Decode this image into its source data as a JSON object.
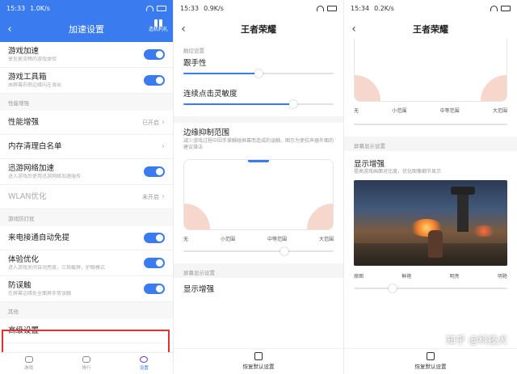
{
  "panel1": {
    "status": {
      "time": "15:33",
      "speed": "1.0K/s"
    },
    "title": "加速设置",
    "header_button": "造机利礼",
    "rows": [
      {
        "type": "toggle",
        "title": "游戏加速",
        "sub": "享受更流畅的游戏体验",
        "on": true
      },
      {
        "type": "toggle",
        "title": "游戏工具箱",
        "sub": "由屏幕右侧边缘向左滑出",
        "on": true
      },
      {
        "type": "header",
        "title": "性能增强"
      },
      {
        "type": "link",
        "title": "性能增强",
        "value": "已开启"
      },
      {
        "type": "link",
        "title": "内存清理白名单"
      },
      {
        "type": "toggle",
        "title": "迅游网络加速",
        "sub": "进入游戏后使用迅游网络加速服务",
        "on": true
      },
      {
        "type": "link",
        "title": "WLAN优化",
        "value": "未开启",
        "dim": true
      },
      {
        "type": "header",
        "title": "游戏防打扰"
      },
      {
        "type": "toggle",
        "title": "来电接通自动免提",
        "on": true
      },
      {
        "type": "toggle",
        "title": "体验优化",
        "sub": "进入游戏关闭自动亮度，三指截屏，护眼模式",
        "on": true
      },
      {
        "type": "toggle",
        "title": "防误触",
        "sub": "在屏幕边缘处全面屏手势误触",
        "on": true
      },
      {
        "type": "header",
        "title": "其他"
      },
      {
        "type": "link",
        "title": "高级设置"
      }
    ],
    "bottom_tabs": [
      {
        "label": "游戏",
        "active": false
      },
      {
        "label": "排行",
        "active": false
      },
      {
        "label": "设置",
        "active": true
      }
    ]
  },
  "panel2": {
    "status": {
      "time": "15:33",
      "speed": "0.9K/s"
    },
    "title": "王者荣耀",
    "section_touch": "触控设置",
    "follow": {
      "label": "跟手性",
      "value": 0.5
    },
    "tap": {
      "label": "连续点击灵敏度",
      "value": 0.73
    },
    "edge": {
      "label": "边缘抑制范围",
      "desc": "减少游戏过程中因手掌触碰屏幕而造成的误触，图示为使抗声器外面的建议操法",
      "ticks": [
        "无",
        "小范围",
        "中等范围",
        "大范围"
      ],
      "value": 0.67
    },
    "section_display": "屏幕显示设置",
    "display_label": "显示增强",
    "restore": "恢复默认设置"
  },
  "panel3": {
    "status": {
      "time": "15:34",
      "speed": "0.2K/s"
    },
    "title": "王者荣耀",
    "edge_ticks": [
      "无",
      "小范围",
      "中等范围",
      "大范围"
    ],
    "section_display": "屏幕显示设置",
    "display_label": "显示增强",
    "display_desc": "提高游戏画面对比度，优化图像细节显示",
    "enhance_ticks": [
      "原图",
      "鲜艳",
      "明亮",
      "明艳"
    ],
    "enhance_value": 0.25,
    "restore": "恢复默认设置",
    "watermark": "知乎 @科技犬"
  },
  "colors": {
    "accent": "#3a7cf0",
    "highlight": "#e4312f"
  }
}
